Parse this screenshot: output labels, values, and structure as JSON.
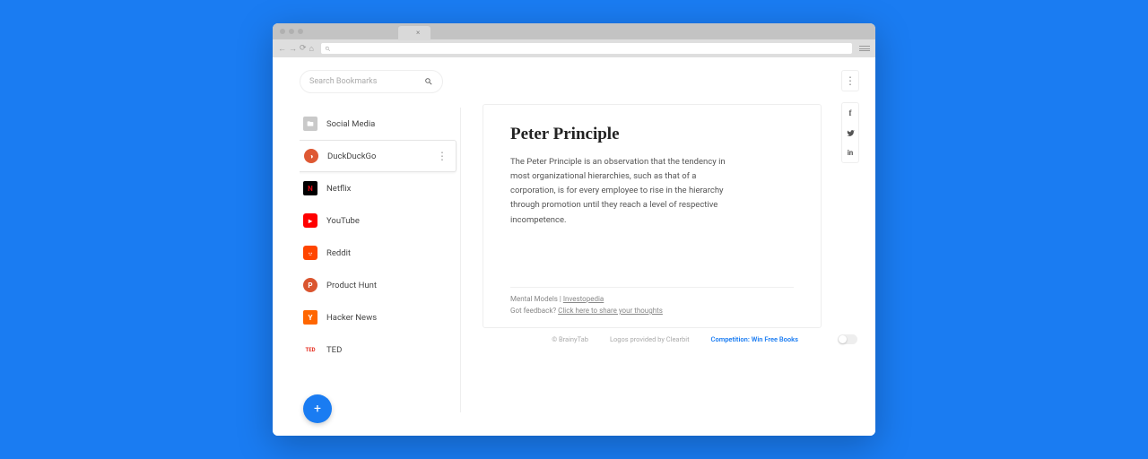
{
  "search": {
    "placeholder": "Search Bookmarks"
  },
  "bookmarks": [
    {
      "label": "Social Media",
      "icon": "folder",
      "color": "#c9c9c9"
    },
    {
      "label": "DuckDuckGo",
      "icon": "ddg",
      "color": "#de5833"
    },
    {
      "label": "Netflix",
      "icon": "N",
      "color": "#000000",
      "fg": "#e50914"
    },
    {
      "label": "YouTube",
      "icon": "▶",
      "color": "#ff0000"
    },
    {
      "label": "Reddit",
      "icon": "r",
      "color": "#ff4500"
    },
    {
      "label": "Product Hunt",
      "icon": "P",
      "color": "#da552f"
    },
    {
      "label": "Hacker News",
      "icon": "Y",
      "color": "#ff6600"
    },
    {
      "label": "TED",
      "icon": "TED",
      "color": "#e62b1e"
    }
  ],
  "card": {
    "title": "Peter Principle",
    "body": "The Peter Principle is an observation that the tendency in most organizational hierarchies, such as that of a corporation, is for every employee to rise in the hierarchy through promotion until they reach a level of respective incompetence.",
    "source_category": "Mental Models",
    "source_sep": " | ",
    "source_link": "Investopedia",
    "feedback_label": "Got feedback? ",
    "feedback_link": "Click here to share your thoughts"
  },
  "footer": {
    "copyright": "© BrainyTab",
    "credits": "Logos provided by Clearbit",
    "promo": "Competition: Win Free Books"
  },
  "social": {
    "f": "f",
    "t": "t",
    "in": "in"
  }
}
